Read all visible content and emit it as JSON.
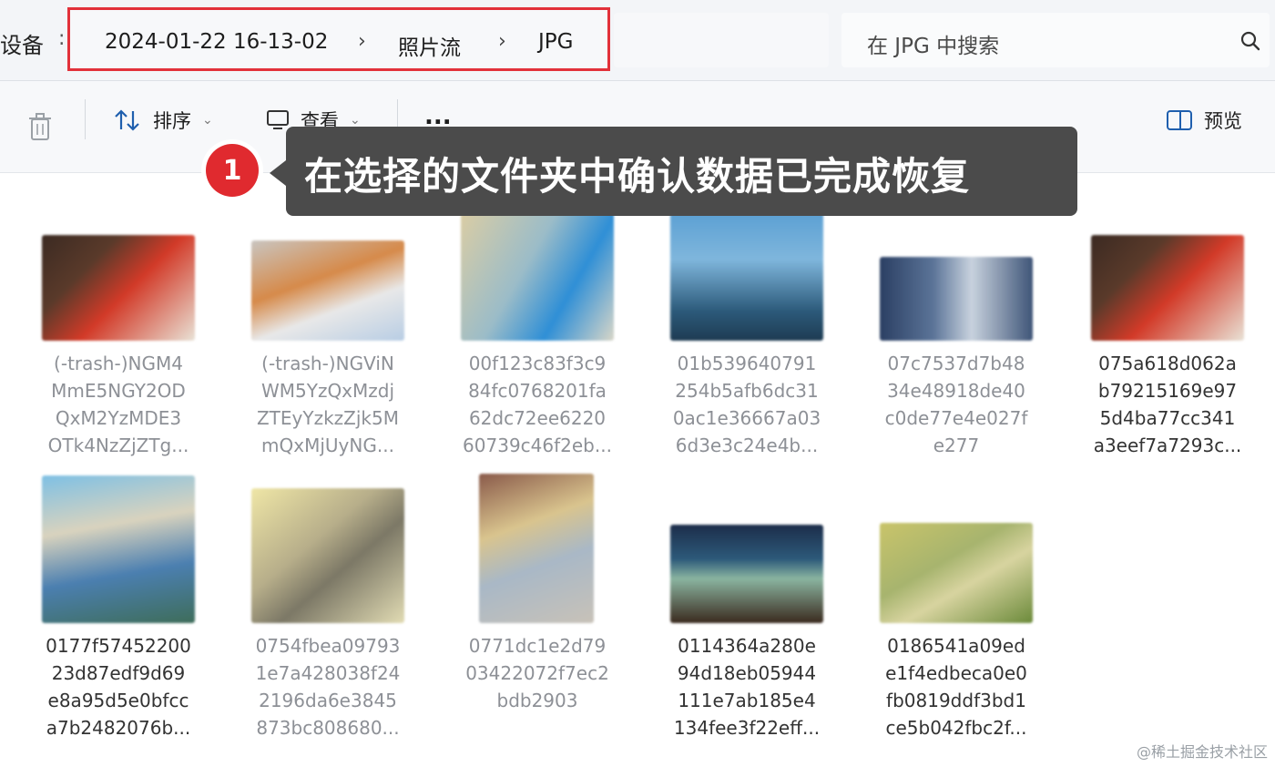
{
  "address": {
    "left_fragment": "设备",
    "breadcrumbs": [
      "2024-01-22 16-13-02",
      "照片流",
      "JPG"
    ]
  },
  "search": {
    "placeholder": "在 JPG 中搜索"
  },
  "toolbar": {
    "sort_label": "排序",
    "view_label": "查看",
    "more_label": "...",
    "preview_label": "预览"
  },
  "callout": {
    "step_number": "1",
    "text": "在选择的文件夹中确认数据已完成恢复"
  },
  "files": [
    {
      "lines": [
        "(-trash-)NGM4",
        "MmE5NGY2OD",
        "QxM2YzMDE3",
        "OTk4NzZjZTg..."
      ]
    },
    {
      "lines": [
        "(-trash-)NGViN",
        "WM5YzQxMzdj",
        "ZTEyYzkzZjk5M",
        "mQxMjUyNG..."
      ]
    },
    {
      "lines": [
        "00f123c83f3c9",
        "84fc0768201fa",
        "62dc72ee6220",
        "60739c46f2eb..."
      ]
    },
    {
      "lines": [
        "01b539640791",
        "254b5afb6dc31",
        "0ac1e36667a03",
        "6d3e3c24e4b..."
      ]
    },
    {
      "lines": [
        "07c7537d7b48",
        "34e48918de40",
        "c0de77e4e027f",
        "e277"
      ]
    },
    {
      "lines": [
        "075a618d062a",
        "b79215169e97",
        "5d4ba77cc341",
        "a3eef7a7293c..."
      ]
    },
    {
      "lines": [
        "0177f57452200",
        "23d87edf9d69",
        "e8a95d5e0bfcc",
        "a7b2482076b..."
      ]
    },
    {
      "lines": [
        "0754fbea09793",
        "1e7a428038f24",
        "2196da6e3845",
        "873bc808680..."
      ]
    },
    {
      "lines": [
        "0771dc1e2d79",
        "03422072f7ec2",
        "bdb2903"
      ]
    },
    {
      "lines": [
        "0114364a280e",
        "94d18eb05944",
        "111e7ab185e4",
        "134fee3f22eff..."
      ]
    },
    {
      "lines": [
        "0186541a09ed",
        "e1f4edbeca0e0",
        "fb0819ddf3bd1",
        "ce5b042fbc2f..."
      ]
    }
  ],
  "watermark": "@稀土掘金技术社区",
  "colors": {
    "highlight_border": "#e2313a",
    "callout_bg": "#4b4b4b",
    "badge": "#e02a2f"
  }
}
